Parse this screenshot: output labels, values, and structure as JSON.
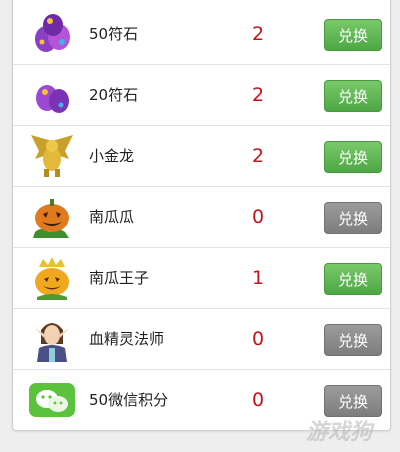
{
  "exchange_list": {
    "button_label": "兑换",
    "items": [
      {
        "name": "50符石",
        "count": "2",
        "icon": "purple-egg-cluster-icon",
        "button_enabled": true
      },
      {
        "name": "20符石",
        "count": "2",
        "icon": "purple-egg-pair-icon",
        "button_enabled": true
      },
      {
        "name": "小金龙",
        "count": "2",
        "icon": "golden-dragon-icon",
        "button_enabled": true
      },
      {
        "name": "南瓜瓜",
        "count": "0",
        "icon": "pumpkin-icon",
        "button_enabled": false
      },
      {
        "name": "南瓜王子",
        "count": "1",
        "icon": "pumpkin-prince-icon",
        "button_enabled": true
      },
      {
        "name": "血精灵法师",
        "count": "0",
        "icon": "blood-elf-mage-icon",
        "button_enabled": false
      },
      {
        "name": "50微信积分",
        "count": "0",
        "icon": "wechat-icon",
        "button_enabled": false
      }
    ]
  },
  "watermark": "游戏狗",
  "colors": {
    "count": "#c7121c",
    "enabled_button": "#5cb551",
    "disabled_button": "#8a8a8a"
  }
}
